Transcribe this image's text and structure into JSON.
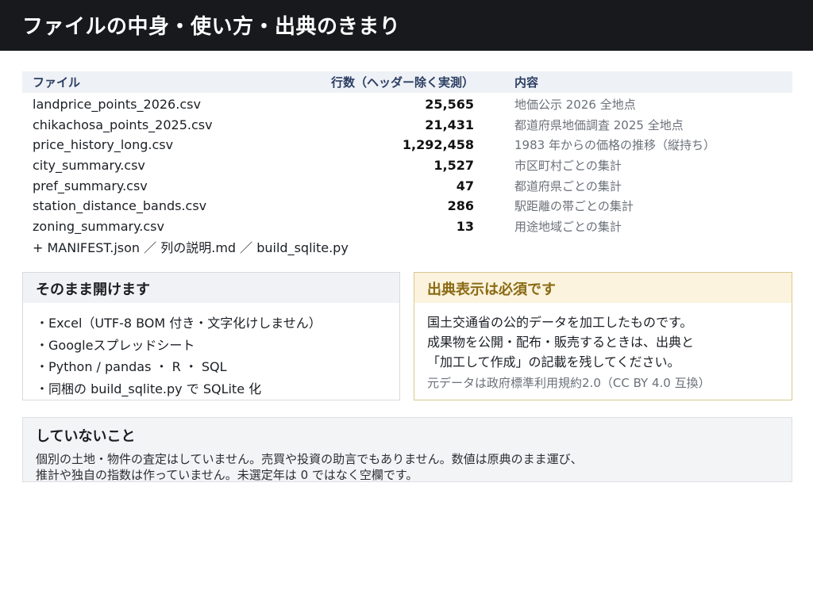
{
  "header": {
    "title": "ファイルの中身・使い方・出典のきまり"
  },
  "table": {
    "columns": [
      "ファイル",
      "行数（ヘッダー除く実測）",
      "内容"
    ],
    "rows": [
      {
        "file": "landprice_points_2026.csv",
        "rows": "25,565",
        "desc": "地価公示 2026 全地点"
      },
      {
        "file": "chikachosa_points_2025.csv",
        "rows": "21,431",
        "desc": "都道府県地価調査 2025 全地点"
      },
      {
        "file": "price_history_long.csv",
        "rows": "1,292,458",
        "desc": "1983 年からの価格の推移（縦持ち）"
      },
      {
        "file": "city_summary.csv",
        "rows": "1,527",
        "desc": "市区町村ごとの集計"
      },
      {
        "file": "pref_summary.csv",
        "rows": "47",
        "desc": "都道府県ごとの集計"
      },
      {
        "file": "station_distance_bands.csv",
        "rows": "286",
        "desc": "駅距離の帯ごとの集計"
      },
      {
        "file": "zoning_summary.csv",
        "rows": "13",
        "desc": "用途地域ごとの集計"
      }
    ],
    "extra": "+ MANIFEST.json ／ 列の説明.md ／ build_sqlite.py"
  },
  "open_card": {
    "title": "そのまま開けます",
    "items": [
      "・Excel（UTF-8 BOM 付き・文字化けしません）",
      "・Googleスプレッドシート",
      "・Python / pandas ・ R ・ SQL",
      "・同梱の build_sqlite.py で SQLite 化"
    ]
  },
  "credit_card": {
    "title": "出典表示は必須です",
    "lines": [
      "国土交通省の公的データを加工したものです。",
      "成果物を公開・配布・販売するときは、出典と",
      "「加工して作成」の記載を残してください。"
    ],
    "note": "元データは政府標準利用規約2.0（CC BY 4.0 互換）"
  },
  "not_done": {
    "title": "していないこと",
    "line1": "個別の土地・物件の査定はしていません。売買や投資の助言でもありません。数値は原典のまま運び、",
    "line2": "推計や独自の指数は作っていません。未選定年は 0 ではなく空欄です。"
  }
}
